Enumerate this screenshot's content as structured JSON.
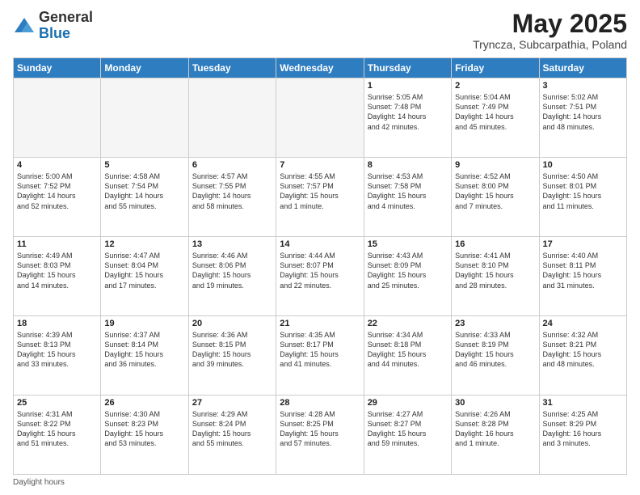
{
  "logo": {
    "general": "General",
    "blue": "Blue"
  },
  "title": "May 2025",
  "subtitle": "Tryncza, Subcarpathia, Poland",
  "days_header": [
    "Sunday",
    "Monday",
    "Tuesday",
    "Wednesday",
    "Thursday",
    "Friday",
    "Saturday"
  ],
  "footer": "Daylight hours",
  "weeks": [
    [
      {
        "day": "",
        "info": "",
        "empty": true
      },
      {
        "day": "",
        "info": "",
        "empty": true
      },
      {
        "day": "",
        "info": "",
        "empty": true
      },
      {
        "day": "",
        "info": "",
        "empty": true
      },
      {
        "day": "1",
        "info": "Sunrise: 5:05 AM\nSunset: 7:48 PM\nDaylight: 14 hours\nand 42 minutes.",
        "empty": false
      },
      {
        "day": "2",
        "info": "Sunrise: 5:04 AM\nSunset: 7:49 PM\nDaylight: 14 hours\nand 45 minutes.",
        "empty": false
      },
      {
        "day": "3",
        "info": "Sunrise: 5:02 AM\nSunset: 7:51 PM\nDaylight: 14 hours\nand 48 minutes.",
        "empty": false
      }
    ],
    [
      {
        "day": "4",
        "info": "Sunrise: 5:00 AM\nSunset: 7:52 PM\nDaylight: 14 hours\nand 52 minutes.",
        "empty": false
      },
      {
        "day": "5",
        "info": "Sunrise: 4:58 AM\nSunset: 7:54 PM\nDaylight: 14 hours\nand 55 minutes.",
        "empty": false
      },
      {
        "day": "6",
        "info": "Sunrise: 4:57 AM\nSunset: 7:55 PM\nDaylight: 14 hours\nand 58 minutes.",
        "empty": false
      },
      {
        "day": "7",
        "info": "Sunrise: 4:55 AM\nSunset: 7:57 PM\nDaylight: 15 hours\nand 1 minute.",
        "empty": false
      },
      {
        "day": "8",
        "info": "Sunrise: 4:53 AM\nSunset: 7:58 PM\nDaylight: 15 hours\nand 4 minutes.",
        "empty": false
      },
      {
        "day": "9",
        "info": "Sunrise: 4:52 AM\nSunset: 8:00 PM\nDaylight: 15 hours\nand 7 minutes.",
        "empty": false
      },
      {
        "day": "10",
        "info": "Sunrise: 4:50 AM\nSunset: 8:01 PM\nDaylight: 15 hours\nand 11 minutes.",
        "empty": false
      }
    ],
    [
      {
        "day": "11",
        "info": "Sunrise: 4:49 AM\nSunset: 8:03 PM\nDaylight: 15 hours\nand 14 minutes.",
        "empty": false
      },
      {
        "day": "12",
        "info": "Sunrise: 4:47 AM\nSunset: 8:04 PM\nDaylight: 15 hours\nand 17 minutes.",
        "empty": false
      },
      {
        "day": "13",
        "info": "Sunrise: 4:46 AM\nSunset: 8:06 PM\nDaylight: 15 hours\nand 19 minutes.",
        "empty": false
      },
      {
        "day": "14",
        "info": "Sunrise: 4:44 AM\nSunset: 8:07 PM\nDaylight: 15 hours\nand 22 minutes.",
        "empty": false
      },
      {
        "day": "15",
        "info": "Sunrise: 4:43 AM\nSunset: 8:09 PM\nDaylight: 15 hours\nand 25 minutes.",
        "empty": false
      },
      {
        "day": "16",
        "info": "Sunrise: 4:41 AM\nSunset: 8:10 PM\nDaylight: 15 hours\nand 28 minutes.",
        "empty": false
      },
      {
        "day": "17",
        "info": "Sunrise: 4:40 AM\nSunset: 8:11 PM\nDaylight: 15 hours\nand 31 minutes.",
        "empty": false
      }
    ],
    [
      {
        "day": "18",
        "info": "Sunrise: 4:39 AM\nSunset: 8:13 PM\nDaylight: 15 hours\nand 33 minutes.",
        "empty": false
      },
      {
        "day": "19",
        "info": "Sunrise: 4:37 AM\nSunset: 8:14 PM\nDaylight: 15 hours\nand 36 minutes.",
        "empty": false
      },
      {
        "day": "20",
        "info": "Sunrise: 4:36 AM\nSunset: 8:15 PM\nDaylight: 15 hours\nand 39 minutes.",
        "empty": false
      },
      {
        "day": "21",
        "info": "Sunrise: 4:35 AM\nSunset: 8:17 PM\nDaylight: 15 hours\nand 41 minutes.",
        "empty": false
      },
      {
        "day": "22",
        "info": "Sunrise: 4:34 AM\nSunset: 8:18 PM\nDaylight: 15 hours\nand 44 minutes.",
        "empty": false
      },
      {
        "day": "23",
        "info": "Sunrise: 4:33 AM\nSunset: 8:19 PM\nDaylight: 15 hours\nand 46 minutes.",
        "empty": false
      },
      {
        "day": "24",
        "info": "Sunrise: 4:32 AM\nSunset: 8:21 PM\nDaylight: 15 hours\nand 48 minutes.",
        "empty": false
      }
    ],
    [
      {
        "day": "25",
        "info": "Sunrise: 4:31 AM\nSunset: 8:22 PM\nDaylight: 15 hours\nand 51 minutes.",
        "empty": false
      },
      {
        "day": "26",
        "info": "Sunrise: 4:30 AM\nSunset: 8:23 PM\nDaylight: 15 hours\nand 53 minutes.",
        "empty": false
      },
      {
        "day": "27",
        "info": "Sunrise: 4:29 AM\nSunset: 8:24 PM\nDaylight: 15 hours\nand 55 minutes.",
        "empty": false
      },
      {
        "day": "28",
        "info": "Sunrise: 4:28 AM\nSunset: 8:25 PM\nDaylight: 15 hours\nand 57 minutes.",
        "empty": false
      },
      {
        "day": "29",
        "info": "Sunrise: 4:27 AM\nSunset: 8:27 PM\nDaylight: 15 hours\nand 59 minutes.",
        "empty": false
      },
      {
        "day": "30",
        "info": "Sunrise: 4:26 AM\nSunset: 8:28 PM\nDaylight: 16 hours\nand 1 minute.",
        "empty": false
      },
      {
        "day": "31",
        "info": "Sunrise: 4:25 AM\nSunset: 8:29 PM\nDaylight: 16 hours\nand 3 minutes.",
        "empty": false
      }
    ]
  ]
}
